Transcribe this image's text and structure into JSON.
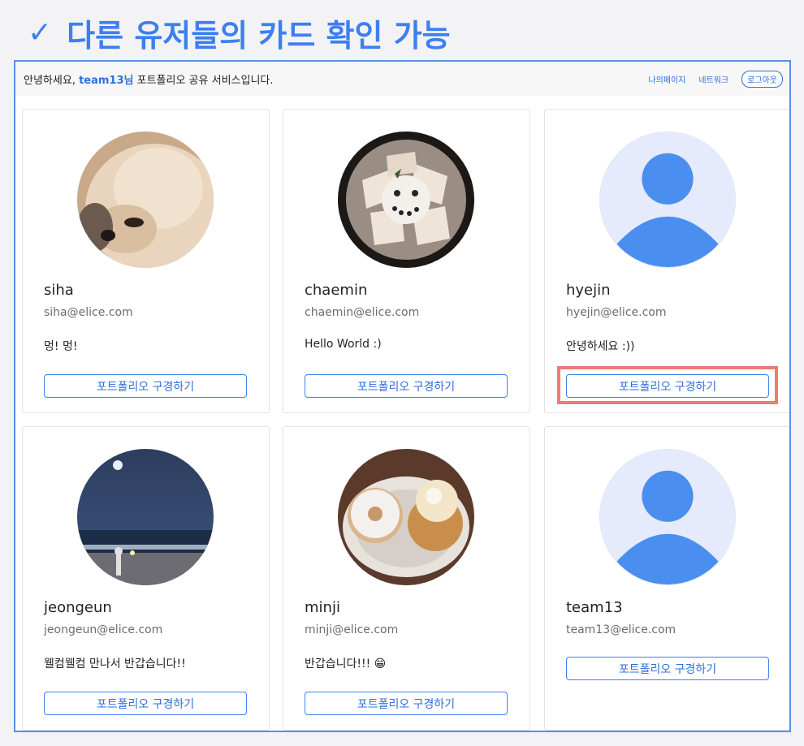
{
  "slide_title": {
    "check_icon": "check-icon",
    "text": "다른 유저들의 카드 확인 가능",
    "accent": "#3d7ff0"
  },
  "navbar": {
    "greeting_prefix": "안녕하세요,",
    "username": "team13님",
    "greeting_suffix": "포트폴리오 공유 서비스입니다.",
    "links": {
      "mypage": "나의페이지",
      "network": "네트워크",
      "logout": "로그아웃"
    }
  },
  "cards": [
    {
      "name": "siha",
      "email": "siha@elice.com",
      "description": "멍! 멍!",
      "button": "포트폴리오 구경하기",
      "avatar": "pomeranian-photo"
    },
    {
      "name": "chaemin",
      "email": "chaemin@elice.com",
      "description": "Hello World :)",
      "button": "포트폴리오 구경하기",
      "avatar": "cracker-plate-photo"
    },
    {
      "name": "hyejin",
      "email": "hyejin@elice.com",
      "description": "안녕하세요 :))",
      "button": "포트폴리오 구경하기",
      "avatar": "default-avatar-icon"
    },
    {
      "name": "jeongeun",
      "email": "jeongeun@elice.com",
      "description": "웰컴웰컴 만나서 반갑습니다!!",
      "button": "포트폴리오 구경하기",
      "avatar": "night-beach-photo"
    },
    {
      "name": "minji",
      "email": "minji@elice.com",
      "description": "반갑습니다!!! 😁",
      "button": "포트폴리오 구경하기",
      "avatar": "donuts-photo"
    },
    {
      "name": "team13",
      "email": "team13@elice.com",
      "description": "",
      "button": "포트폴리오 구경하기",
      "avatar": "default-avatar-icon"
    }
  ],
  "colors": {
    "primary": "#2f6fde",
    "highlight": "#ee7a7a",
    "avatar_bg": "#e5ebfc",
    "avatar_fg": "#4a8ef0"
  }
}
